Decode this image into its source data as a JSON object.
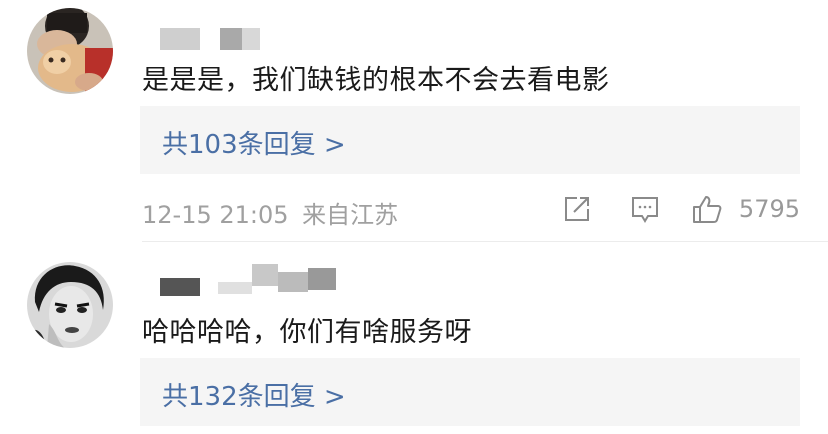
{
  "comments": [
    {
      "text": "是是是，我们缺钱的根本不会去看电影",
      "reply_link": "共103条回复 >",
      "time": "12-15 21:05",
      "location": "来自江苏",
      "likes": "5795"
    },
    {
      "text": "哈哈哈哈，你们有啥服务呀",
      "reply_link": "共132条回复 >"
    }
  ],
  "icons": [
    "share-icon",
    "comment-icon",
    "like-icon"
  ],
  "colors": {
    "link": "#4a6fa5",
    "meta": "#a0a0a0",
    "reply_bg": "#f5f5f5"
  }
}
